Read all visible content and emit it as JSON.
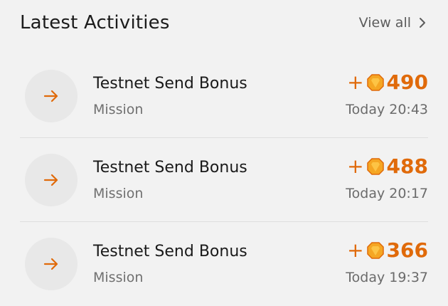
{
  "header": {
    "title": "Latest Activities",
    "view_all_label": "View all"
  },
  "colors": {
    "accent": "#e06a0a",
    "gem_fill": "#f5a623",
    "background": "#f2f2f2",
    "icon_circle": "#e8e8e8"
  },
  "activities": [
    {
      "title": "Testnet Send Bonus",
      "subtitle": "Mission",
      "sign": "+",
      "amount": "490",
      "time": "Today 20:43",
      "icon": "arrow-right-icon"
    },
    {
      "title": "Testnet Send Bonus",
      "subtitle": "Mission",
      "sign": "+",
      "amount": "488",
      "time": "Today 20:17",
      "icon": "arrow-right-icon"
    },
    {
      "title": "Testnet Send Bonus",
      "subtitle": "Mission",
      "sign": "+",
      "amount": "366",
      "time": "Today 19:37",
      "icon": "arrow-right-icon"
    }
  ]
}
